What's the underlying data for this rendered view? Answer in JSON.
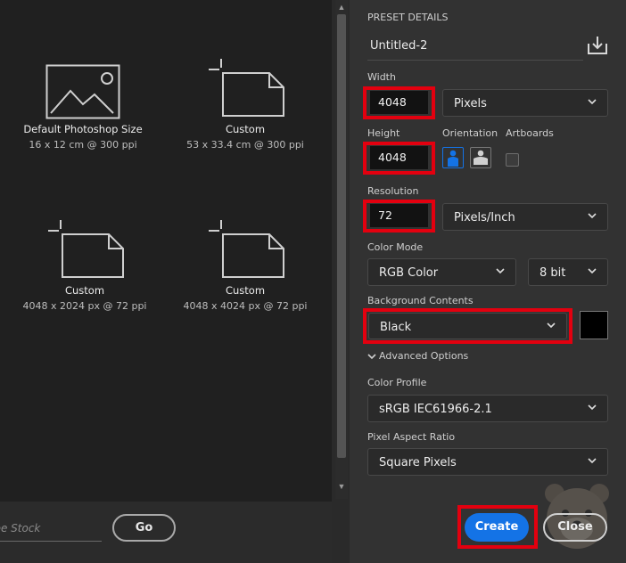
{
  "presets": [
    {
      "name": "Default Photoshop Size",
      "desc": "16 x 12 cm @ 300 ppi",
      "icon": "image-icon"
    },
    {
      "name": "Custom",
      "desc": "53 x 33.4 cm @ 300 ppi",
      "icon": "document-icon"
    },
    {
      "name": "Custom",
      "desc": "4048 x 2024 px @ 72 ppi",
      "icon": "document-icon"
    },
    {
      "name": "Custom",
      "desc": "4048 x 4024 px @ 72 ppi",
      "icon": "document-icon"
    }
  ],
  "stock_search": {
    "value": "obe Stock"
  },
  "go_label": "Go",
  "details": {
    "header": "PRESET DETAILS",
    "doc_title": "Untitled-2",
    "width_label": "Width",
    "width_value": "4048",
    "width_unit": "Pixels",
    "height_label": "Height",
    "height_value": "4048",
    "orientation_label": "Orientation",
    "artboards_label": "Artboards",
    "resolution_label": "Resolution",
    "resolution_value": "72",
    "resolution_unit": "Pixels/Inch",
    "color_mode_label": "Color Mode",
    "color_mode_value": "RGB Color",
    "bit_depth_value": "8 bit",
    "background_label": "Background Contents",
    "background_value": "Black",
    "advanced_label": "Advanced Options",
    "color_profile_label": "Color Profile",
    "color_profile_value": "sRGB IEC61966-2.1",
    "pixel_aspect_label": "Pixel Aspect Ratio",
    "pixel_aspect_value": "Square Pixels"
  },
  "buttons": {
    "create": "Create",
    "close": "Close"
  },
  "colors": {
    "accent": "#1473e6",
    "highlight": "#e3000f",
    "background_swatch": "#000000"
  }
}
